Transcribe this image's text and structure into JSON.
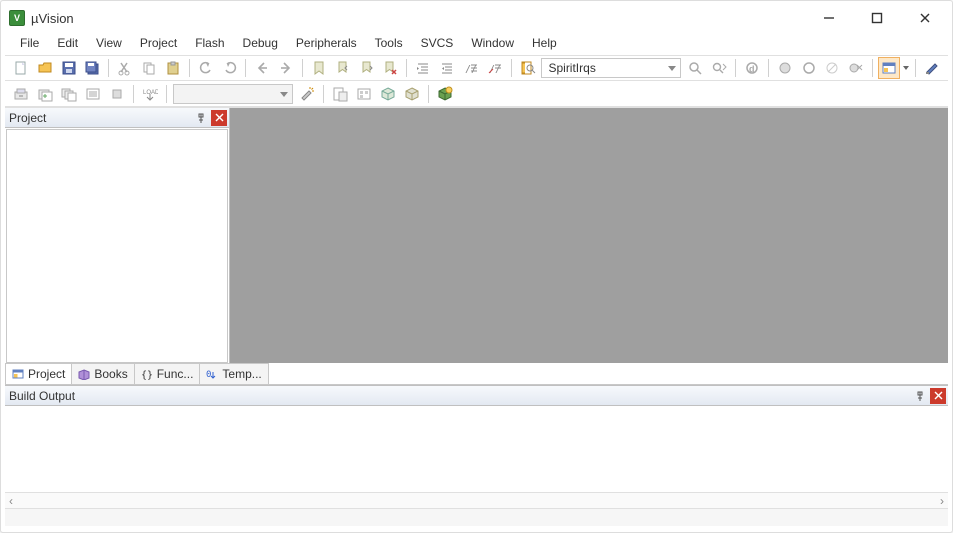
{
  "title": "µVision",
  "menu": [
    "File",
    "Edit",
    "View",
    "Project",
    "Flash",
    "Debug",
    "Peripherals",
    "Tools",
    "SVCS",
    "Window",
    "Help"
  ],
  "toolbar": {
    "search_text": "SpiritIrqs"
  },
  "target_combo": "",
  "panels": {
    "project": {
      "title": "Project"
    },
    "output": {
      "title": "Build Output"
    }
  },
  "tabs": {
    "project": "Project",
    "books": "Books",
    "functions": "Func...",
    "templates": "Temp..."
  }
}
